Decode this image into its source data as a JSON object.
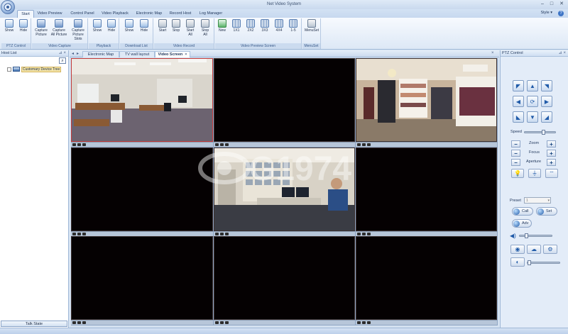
{
  "window": {
    "title": "Net Video System",
    "minimize": "–",
    "maximize": "□",
    "close": "✕"
  },
  "menu_tabs": [
    "Start",
    "Video Preview",
    "Control Panel",
    "Video Playback",
    "Electronic Map",
    "Record Host",
    "Log Manager"
  ],
  "style_label": "Style",
  "help": "?",
  "ribbon": {
    "ptz_control": {
      "label": "PTZ Control",
      "buttons": [
        "Show",
        "Hide"
      ]
    },
    "video_capture": {
      "label": "Video Capture",
      "buttons": [
        "Capture\nPicture",
        "Capture\nAll Picture",
        "Capture\nPicture Slots"
      ]
    },
    "playback": {
      "label": "Playback",
      "buttons": [
        "Show",
        "Hide"
      ]
    },
    "download_list": {
      "label": "Download List",
      "buttons": [
        "Show",
        "Hide"
      ]
    },
    "video_record": {
      "label": "Video Record",
      "buttons": [
        "Start",
        "Stop",
        "Start\nAll",
        "Stop\nAll"
      ]
    },
    "video_preview_screen": {
      "label": "Video Preview Screen",
      "buttons": [
        "New",
        "1X1",
        "2X2",
        "3X3",
        "4X4",
        "1-5"
      ]
    },
    "menuset": {
      "label": "MenuSet",
      "buttons": [
        "MenuSet"
      ]
    }
  },
  "host_list": {
    "title": "Host List",
    "pin": "⊿ ×",
    "tree_root": "Customary Device Tree",
    "talk_state": "Talk State"
  },
  "view_tabs": [
    "Electronic Map",
    "TV wall layout",
    "Video Screen"
  ],
  "ptz": {
    "title": "PTZ Control",
    "pin": "⊿ ×",
    "speed": "Speed",
    "zoom": "Zoom",
    "focus": "Focus",
    "aperture": "Aperture",
    "preset": "Preset",
    "preset_value": "1",
    "call": "Call",
    "set": "Set",
    "adv": "Adv",
    "plus": "+",
    "minus": "−"
  },
  "watermark": "G1974",
  "colors": {
    "accent": "#1f5aa8",
    "selected_cell_border": "#c23a3a",
    "video_black": "#050102"
  }
}
